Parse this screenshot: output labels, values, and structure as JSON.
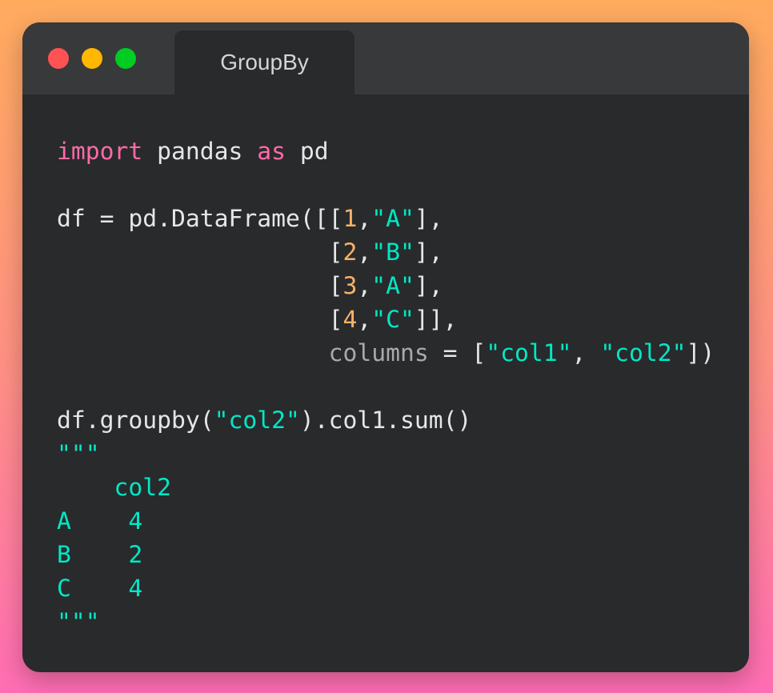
{
  "window": {
    "title": "GroupBy",
    "controls": [
      {
        "name": "close",
        "color": "#ff5252"
      },
      {
        "name": "minimize",
        "color": "#ffb700"
      },
      {
        "name": "maximize",
        "color": "#00cc22"
      }
    ]
  },
  "code": {
    "lines": [
      [
        [
          "import",
          "kw"
        ],
        [
          " pandas ",
          "pl"
        ],
        [
          "as",
          "kw"
        ],
        [
          " pd",
          "pl"
        ]
      ],
      [],
      [
        [
          "df = pd.DataFrame([[",
          "pl"
        ],
        [
          "1",
          "num"
        ],
        [
          ",",
          "pl"
        ],
        [
          "\"A\"",
          "str"
        ],
        [
          "],",
          "pl"
        ]
      ],
      [
        [
          "                   [",
          "pl"
        ],
        [
          "2",
          "num"
        ],
        [
          ",",
          "pl"
        ],
        [
          "\"B\"",
          "str"
        ],
        [
          "],",
          "pl"
        ]
      ],
      [
        [
          "                   [",
          "pl"
        ],
        [
          "3",
          "num"
        ],
        [
          ",",
          "pl"
        ],
        [
          "\"A\"",
          "str"
        ],
        [
          "],",
          "pl"
        ]
      ],
      [
        [
          "                   [",
          "pl"
        ],
        [
          "4",
          "num"
        ],
        [
          ",",
          "pl"
        ],
        [
          "\"C\"",
          "str"
        ],
        [
          "]],",
          "pl"
        ]
      ],
      [
        [
          "                   ",
          "pl"
        ],
        [
          "columns",
          "arg"
        ],
        [
          " = [",
          "pl"
        ],
        [
          "\"col1\"",
          "str"
        ],
        [
          ", ",
          "pl"
        ],
        [
          "\"col2\"",
          "str"
        ],
        [
          "])",
          "pl"
        ]
      ],
      [],
      [
        [
          "df.groupby(",
          "pl"
        ],
        [
          "\"col2\"",
          "str"
        ],
        [
          ").col1.sum()",
          "pl"
        ]
      ],
      [
        [
          "\"\"\"",
          "str"
        ]
      ],
      [
        [
          "    col2",
          "str"
        ]
      ],
      [
        [
          "A    4",
          "str"
        ]
      ],
      [
        [
          "B    2",
          "str"
        ]
      ],
      [
        [
          "C    4",
          "str"
        ]
      ],
      [
        [
          "\"\"\"",
          "str"
        ]
      ]
    ]
  }
}
